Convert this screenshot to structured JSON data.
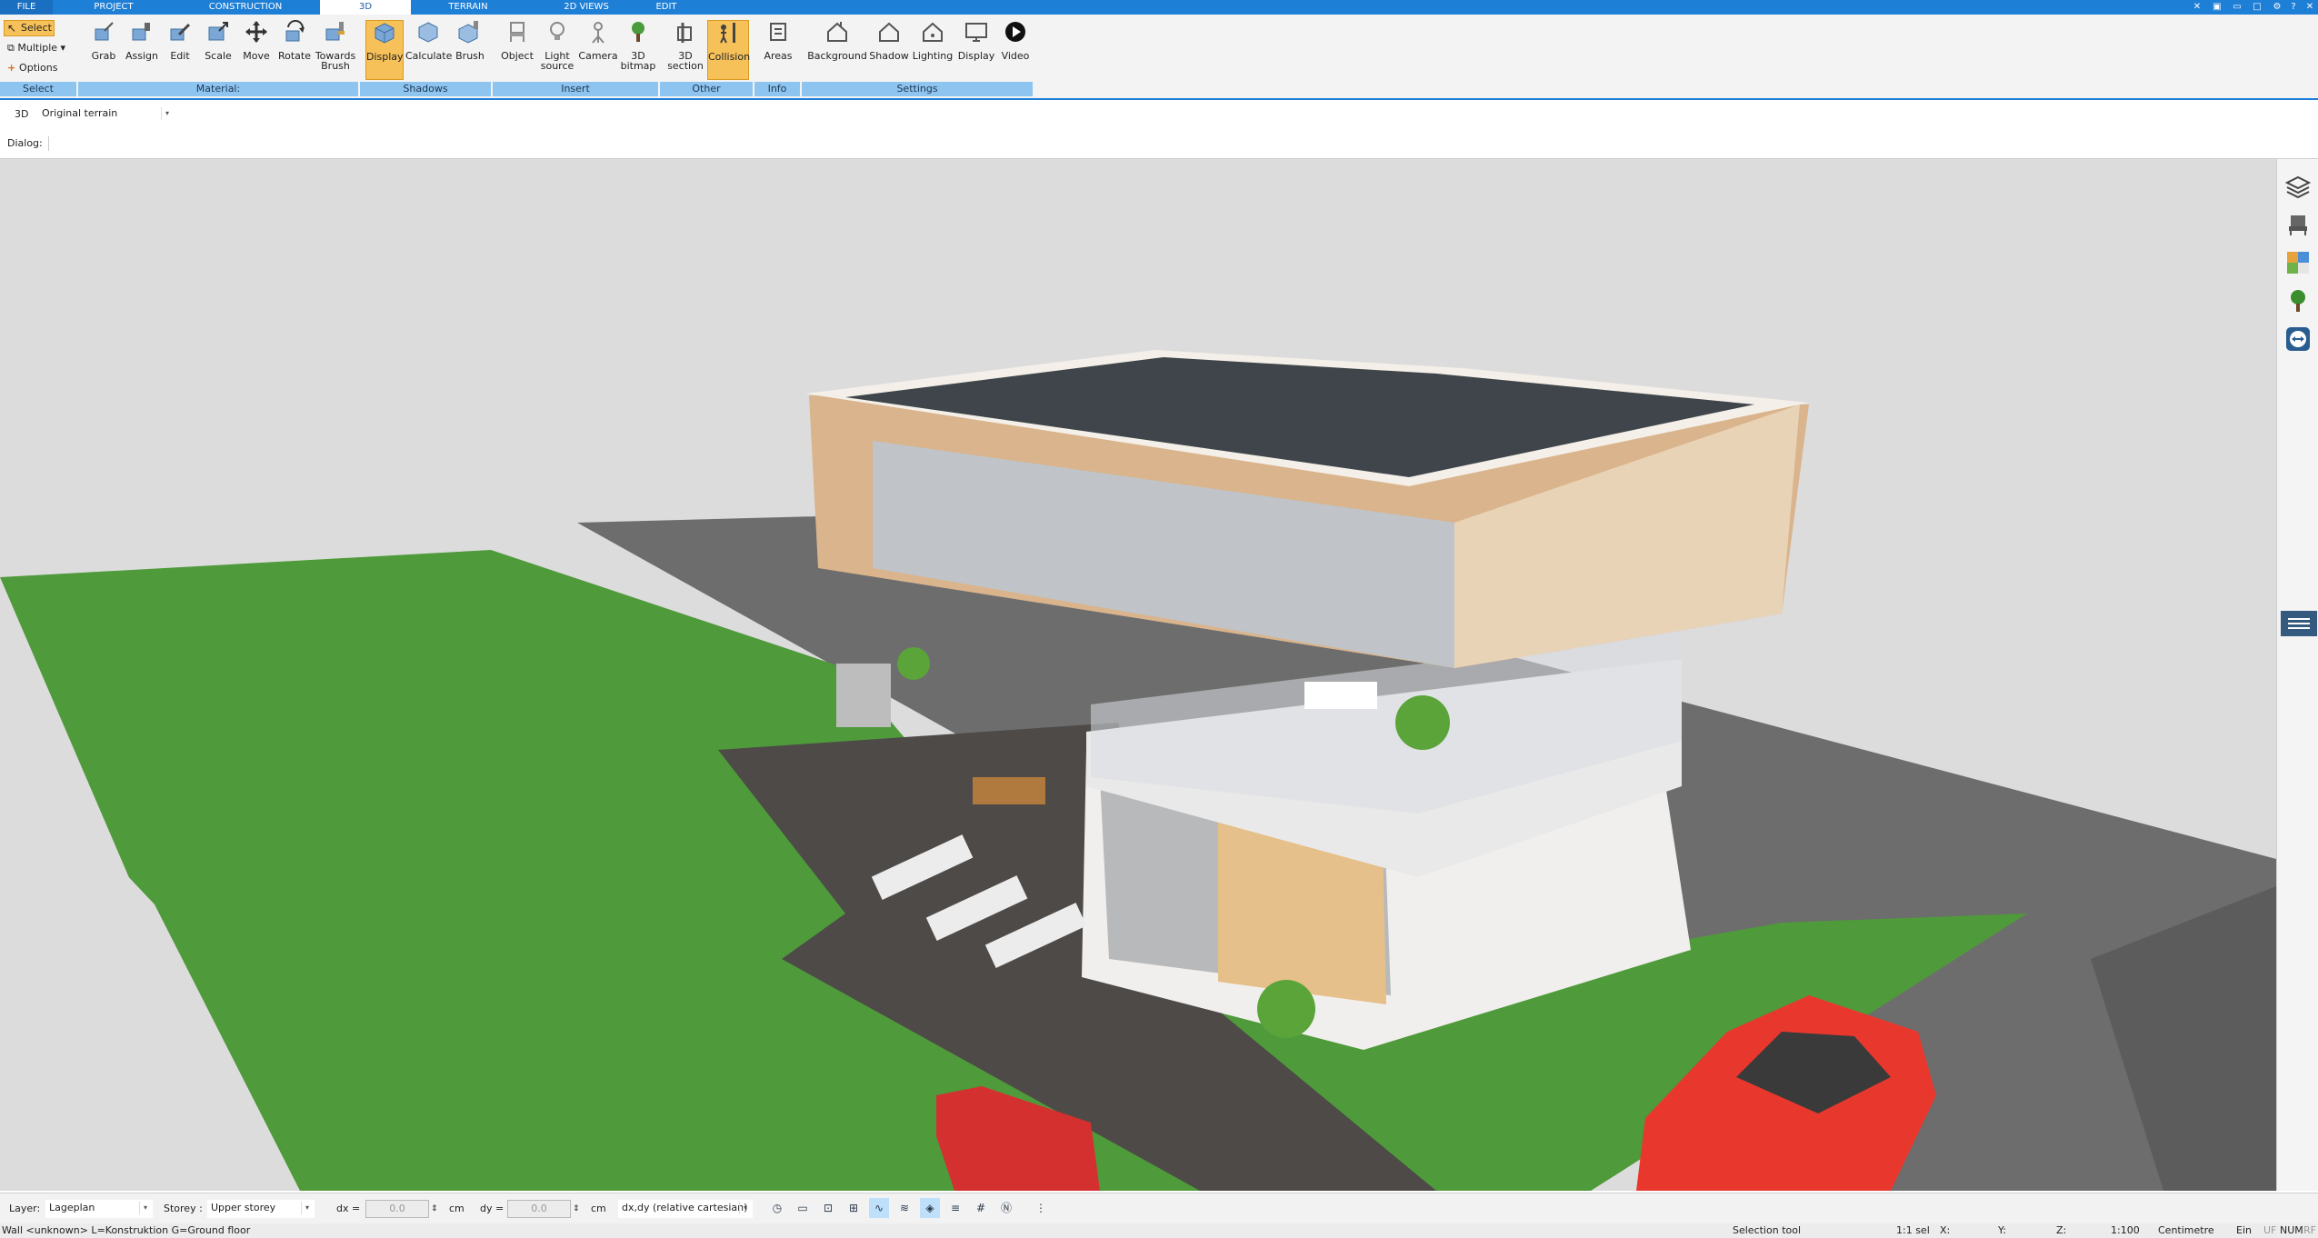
{
  "menu": {
    "tabs": [
      "FILE",
      "PROJECT",
      "CONSTRUCTION",
      "3D",
      "TERRAIN",
      "2D VIEWS",
      "EDIT"
    ],
    "active": "3D"
  },
  "ribbon": {
    "select_group": {
      "select": "Select",
      "multiple": "Multiple",
      "options": "Options",
      "label": "Select"
    },
    "material": {
      "label": "Material:",
      "buttons": [
        "Grab",
        "Assign",
        "Edit",
        "Scale",
        "Move",
        "Rotate",
        "Towards\nBrush"
      ]
    },
    "shadows": {
      "label": "Shadows",
      "buttons": [
        "Display",
        "Calculate",
        "Brush"
      ]
    },
    "insert": {
      "label": "Insert",
      "buttons": [
        "Object",
        "Light\nsource",
        "Camera",
        "3D\nbitmap"
      ]
    },
    "other": {
      "label": "Other",
      "buttons": [
        "3D\nsection",
        "Collision"
      ]
    },
    "info": {
      "label": "Info",
      "buttons": [
        "Areas"
      ]
    },
    "settings": {
      "label": "Settings",
      "buttons": [
        "Background",
        "Shadow",
        "Lighting",
        "Display",
        "Video"
      ]
    }
  },
  "viewbar": {
    "mode": "3D",
    "terrain": "Original terrain"
  },
  "dialogbar": {
    "label": "Dialog:"
  },
  "status": {
    "layer_label": "Layer:",
    "layer_value": "Lageplan",
    "storey_label": "Storey :",
    "storey_value": "Upper storey",
    "dx_label": "dx =",
    "dx_value": "0.0",
    "dx_unit": "cm",
    "dy_label": "dy =",
    "dy_value": "0.0",
    "dy_unit": "cm",
    "coord_mode": "dx,dy (relative cartesian)"
  },
  "infobar": {
    "hint": "Wall <unknown> L=Konstruktion G=Ground floor",
    "tool": "Selection tool",
    "sel": "1:1 sel",
    "x": "X:",
    "y": "Y:",
    "z": "Z:",
    "scale": "1:100",
    "unit": "Centimetre",
    "ein": "Ein",
    "uf": "UF",
    "num": "NUM",
    "rf": "RF"
  },
  "colors": {
    "accent": "#1e7fd6",
    "active_button": "#f7c15a",
    "group_band": "#8ec5f0",
    "grass": "#4f9a3a",
    "sky": "#dcdcdc",
    "car": "#e8382e"
  }
}
